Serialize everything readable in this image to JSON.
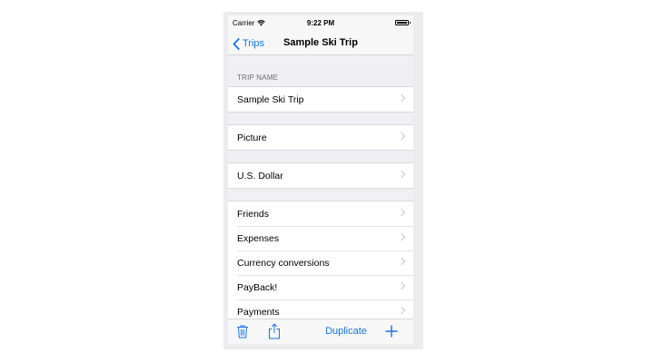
{
  "status_bar": {
    "carrier": "Carrier",
    "time": "9:22 PM",
    "battery_level": 1.0
  },
  "nav": {
    "back_label": "Trips",
    "title": "Sample Ski Trip"
  },
  "sections": {
    "trip_name_header": "TRIP NAME",
    "trip_name": "Sample Ski Trip",
    "picture": "Picture",
    "currency": "U.S. Dollar",
    "items": [
      {
        "label": "Friends"
      },
      {
        "label": "Expenses"
      },
      {
        "label": "Currency conversions"
      },
      {
        "label": "PayBack!"
      },
      {
        "label": "Payments"
      }
    ]
  },
  "toolbar": {
    "duplicate_label": "Duplicate",
    "icons": [
      "trash-icon",
      "share-icon",
      "plus-icon"
    ]
  },
  "colors": {
    "tint": "#1a73e8",
    "group_background": "#efeff4",
    "chevron": "#c7c7cc",
    "section_header_text": "#6d6d72"
  }
}
